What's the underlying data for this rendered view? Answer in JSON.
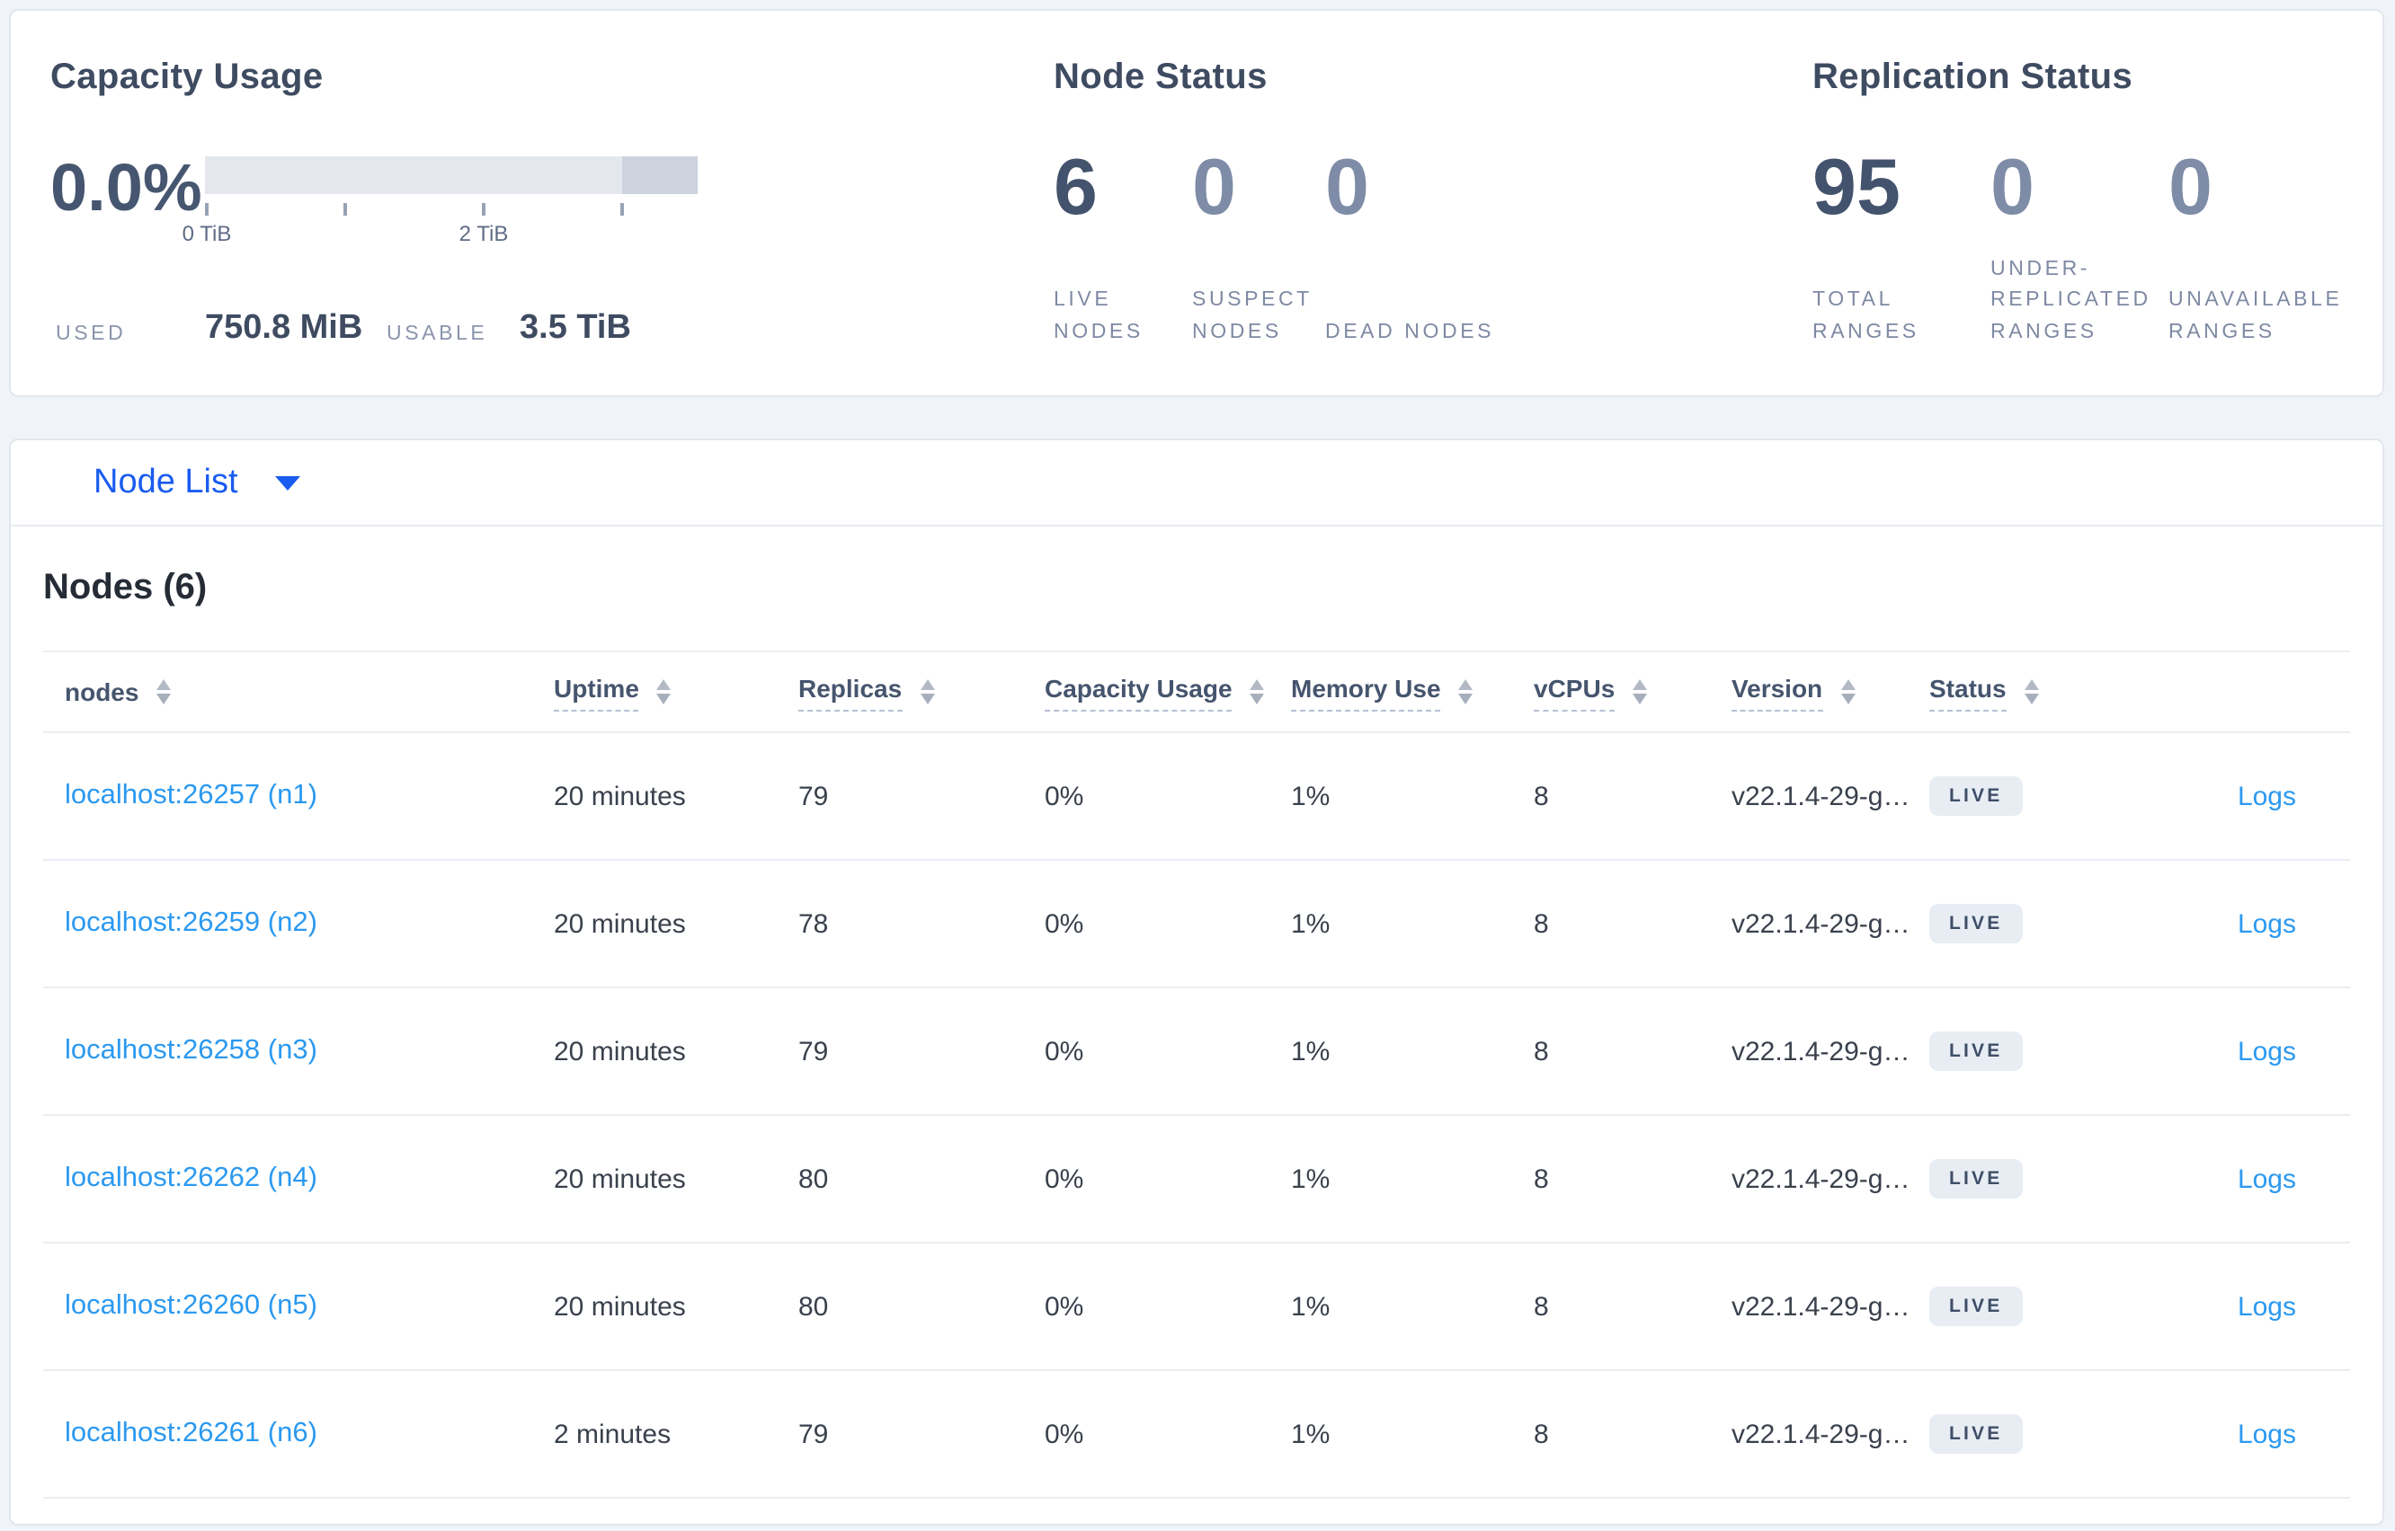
{
  "summary": {
    "capacity": {
      "title": "Capacity Usage",
      "percent_used": "0.0%",
      "axis_ticks": [
        "0 TiB",
        "2 TiB"
      ],
      "used_label": "USED",
      "used_value": "750.8 MiB",
      "usable_label": "USABLE",
      "usable_value": "3.5 TiB"
    },
    "node_status": {
      "title": "Node Status",
      "stats": [
        {
          "value": "6",
          "label": "LIVE NODES"
        },
        {
          "value": "0",
          "label": "SUSPECT NODES"
        },
        {
          "value": "0",
          "label": "DEAD NODES"
        }
      ]
    },
    "replication_status": {
      "title": "Replication Status",
      "stats": [
        {
          "value": "95",
          "label": "TOTAL RANGES"
        },
        {
          "value": "0",
          "label": "UNDER-REPLICATED RANGES"
        },
        {
          "value": "0",
          "label": "UNAVAILABLE RANGES"
        }
      ]
    }
  },
  "node_list": {
    "dropdown_label": "Node List",
    "heading": "Nodes (6)",
    "columns": [
      "nodes",
      "Uptime",
      "Replicas",
      "Capacity Usage",
      "Memory Use",
      "vCPUs",
      "Version",
      "Status"
    ],
    "logs_label": "Logs",
    "rows": [
      {
        "name": "localhost:26257 (n1)",
        "uptime": "20 minutes",
        "replicas": "79",
        "capacity_usage": "0%",
        "memory_use": "1%",
        "vcpus": "8",
        "version": "v22.1.4-29-g…",
        "status": "LIVE"
      },
      {
        "name": "localhost:26259 (n2)",
        "uptime": "20 minutes",
        "replicas": "78",
        "capacity_usage": "0%",
        "memory_use": "1%",
        "vcpus": "8",
        "version": "v22.1.4-29-g…",
        "status": "LIVE"
      },
      {
        "name": "localhost:26258 (n3)",
        "uptime": "20 minutes",
        "replicas": "79",
        "capacity_usage": "0%",
        "memory_use": "1%",
        "vcpus": "8",
        "version": "v22.1.4-29-g…",
        "status": "LIVE"
      },
      {
        "name": "localhost:26262 (n4)",
        "uptime": "20 minutes",
        "replicas": "80",
        "capacity_usage": "0%",
        "memory_use": "1%",
        "vcpus": "8",
        "version": "v22.1.4-29-g…",
        "status": "LIVE"
      },
      {
        "name": "localhost:26260 (n5)",
        "uptime": "20 minutes",
        "replicas": "80",
        "capacity_usage": "0%",
        "memory_use": "1%",
        "vcpus": "8",
        "version": "v22.1.4-29-g…",
        "status": "LIVE"
      },
      {
        "name": "localhost:26261 (n6)",
        "uptime": "2 minutes",
        "replicas": "79",
        "capacity_usage": "0%",
        "memory_use": "1%",
        "vcpus": "8",
        "version": "v22.1.4-29-g…",
        "status": "LIVE"
      }
    ]
  },
  "colors": {
    "accent_blue": "#1a5cf0",
    "link_blue": "#2b99f0",
    "dark_stat": "#44536d",
    "muted_stat": "#7e8ca7",
    "badge_bg": "#e8edf4",
    "bar_light": "#e4e7ee",
    "bar_dark": "#ccd2de"
  }
}
